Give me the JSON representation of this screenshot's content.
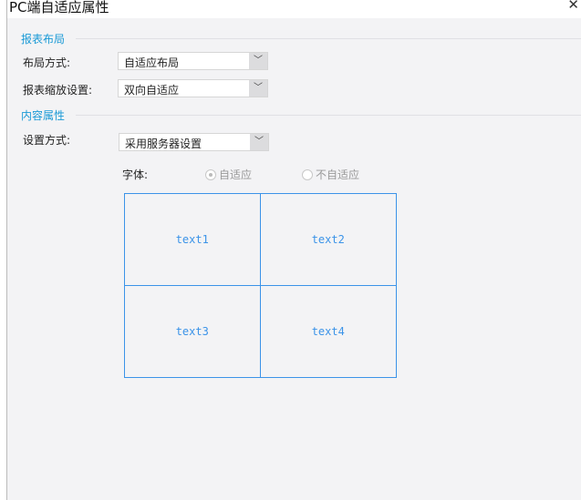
{
  "dialog": {
    "title": "PC端自适应属性",
    "close": "✕"
  },
  "layout_group": {
    "title": "报表布局",
    "layout_label": "布局方式:",
    "layout_value": "自适应布局",
    "scale_label": "报表缩放设置:",
    "scale_value": "双向自适应"
  },
  "content_group": {
    "title": "内容属性",
    "setting_label": "设置方式:",
    "setting_value": "采用服务器设置",
    "font_label": "字体:",
    "font_options": [
      {
        "label": "自适应",
        "checked": true
      },
      {
        "label": "不自适应",
        "checked": false
      }
    ]
  },
  "preview": {
    "cells": [
      "text1",
      "text2",
      "text3",
      "text4"
    ]
  },
  "icons": {
    "dropdown": "chevron-down-icon"
  }
}
